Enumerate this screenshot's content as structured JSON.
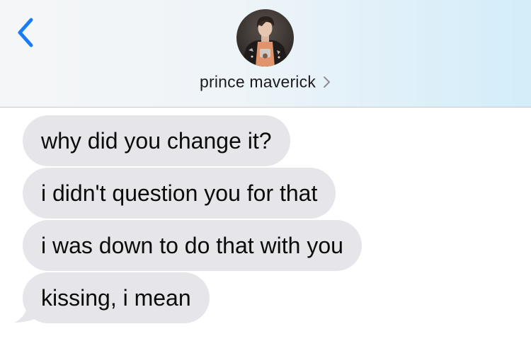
{
  "header": {
    "contact_name": "prince maverick",
    "back_icon": "chevron-left-icon",
    "details_icon": "chevron-right-icon",
    "accent_color": "#1a7cf5"
  },
  "messages": [
    {
      "direction": "incoming",
      "text": "why did you change it?"
    },
    {
      "direction": "incoming",
      "text": "i didn't question you for that"
    },
    {
      "direction": "incoming",
      "text": "i was down to do that with you"
    },
    {
      "direction": "incoming",
      "text": "kissing, i mean"
    }
  ],
  "colors": {
    "incoming_bubble": "#e5e5ea",
    "header_bg_start": "#f5f6f7",
    "header_bg_end": "#d3edf9"
  }
}
